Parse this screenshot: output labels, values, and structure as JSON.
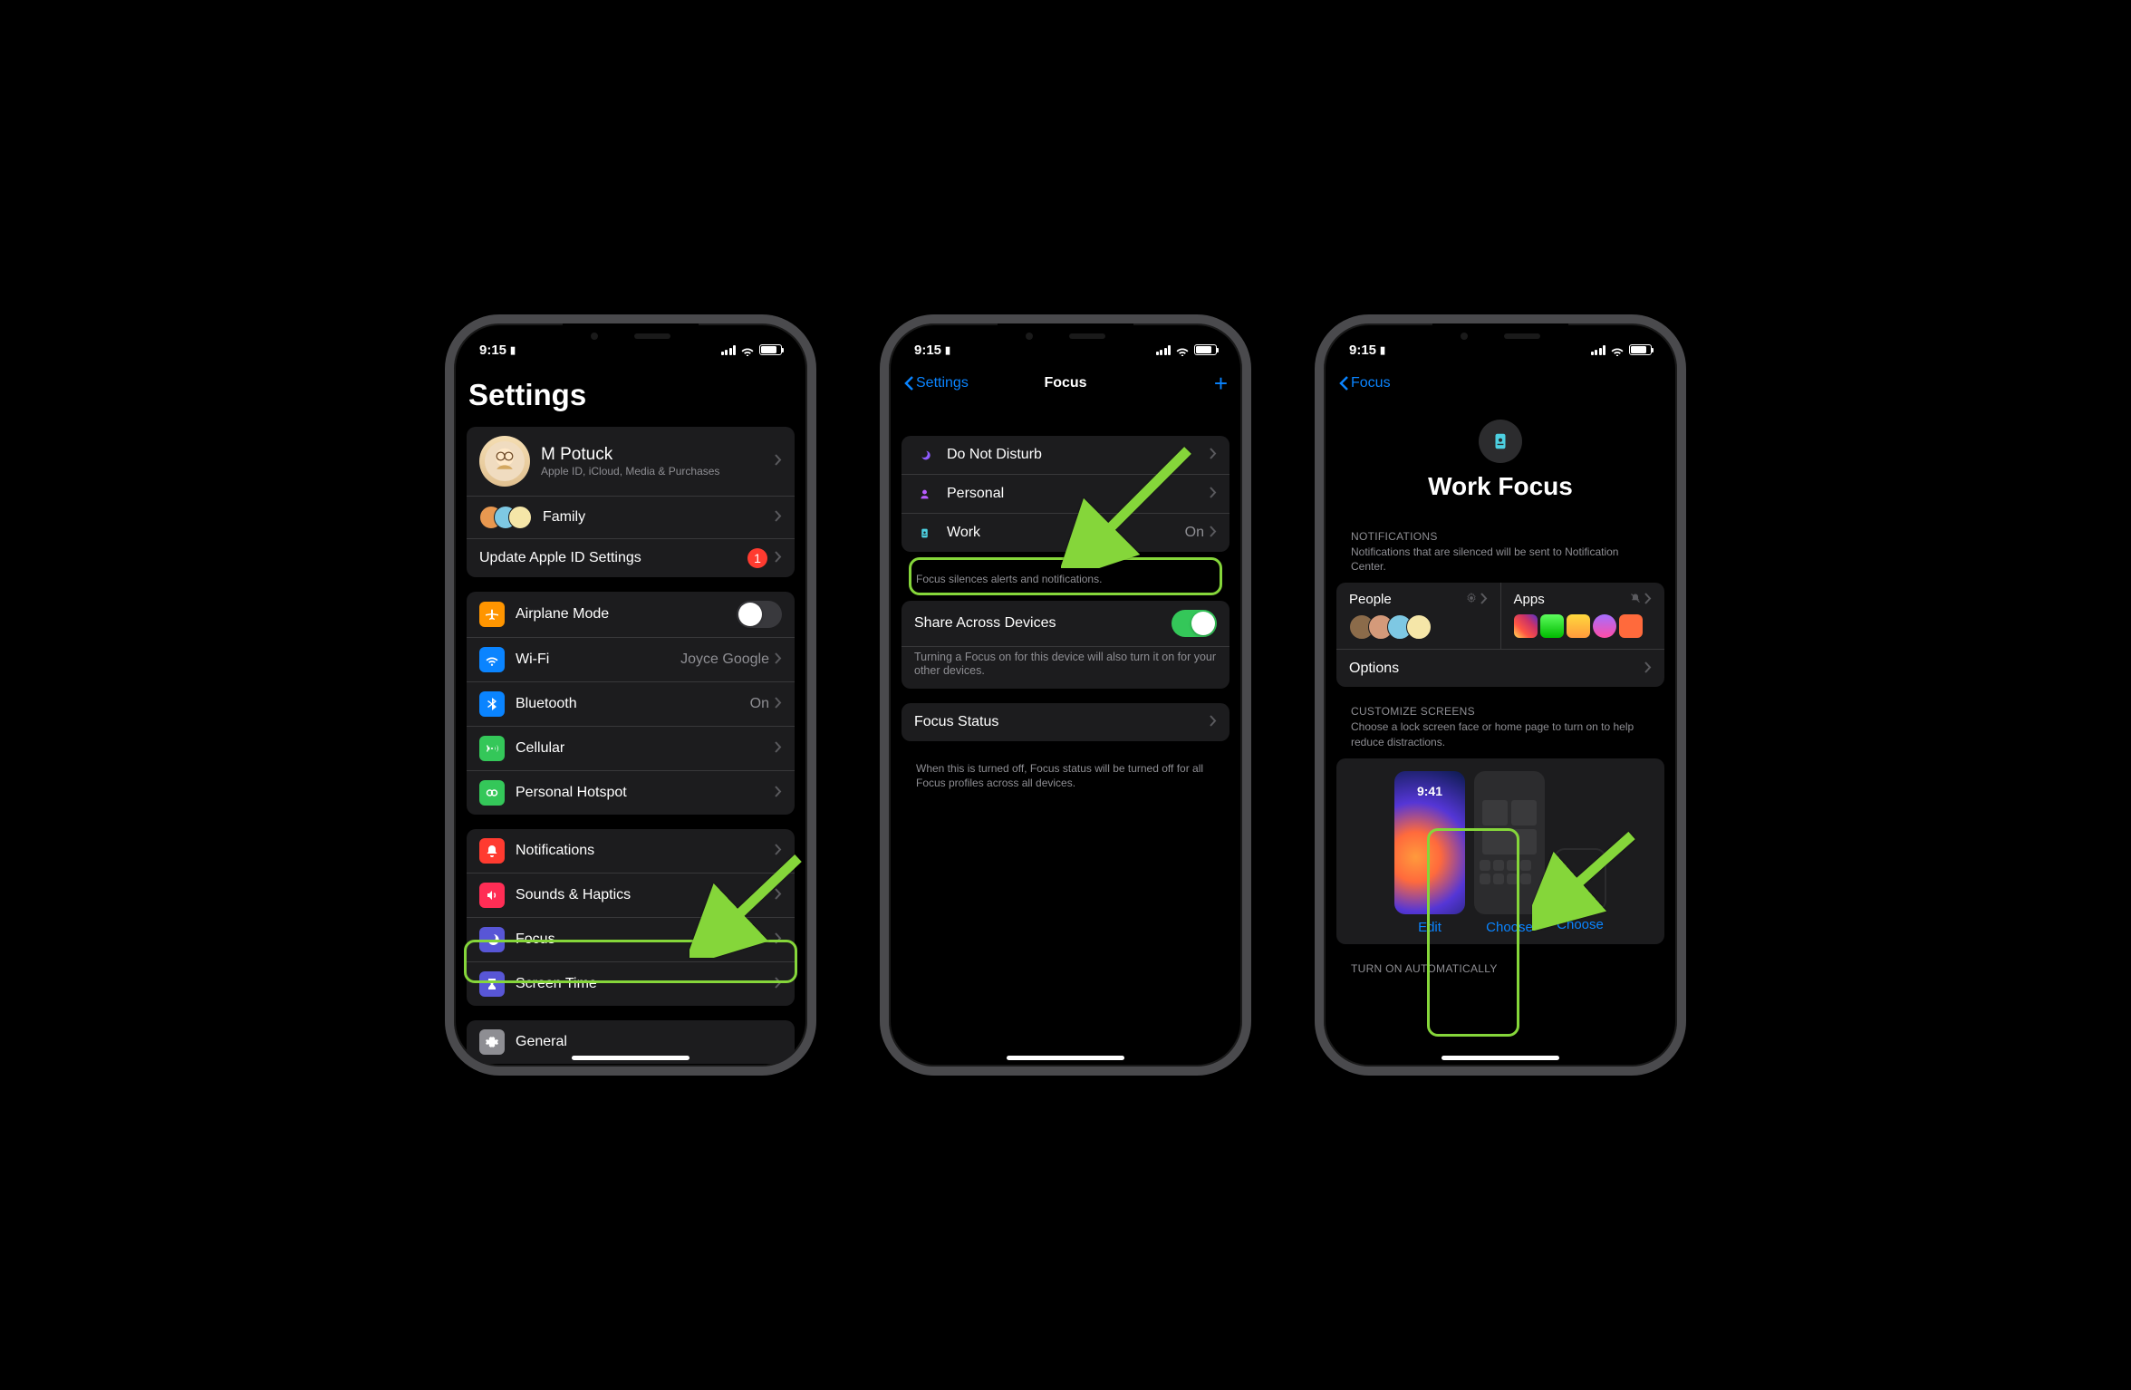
{
  "status": {
    "time": "9:15"
  },
  "s1": {
    "title": "Settings",
    "profile": {
      "name": "M Potuck",
      "sub": "Apple ID, iCloud, Media & Purchases"
    },
    "family": "Family",
    "update": {
      "label": "Update Apple ID Settings",
      "badge": "1"
    },
    "airplane": "Airplane Mode",
    "wifi": {
      "label": "Wi-Fi",
      "value": "Joyce Google"
    },
    "bluetooth": {
      "label": "Bluetooth",
      "value": "On"
    },
    "cellular": "Cellular",
    "hotspot": "Personal Hotspot",
    "notifications": "Notifications",
    "sounds": "Sounds & Haptics",
    "focus": "Focus",
    "screentime": "Screen Time",
    "general": "General"
  },
  "s2": {
    "back": "Settings",
    "title": "Focus",
    "dnd": "Do Not Disturb",
    "personal": "Personal",
    "work": {
      "label": "Work",
      "value": "On"
    },
    "footer1": "Focus silences alerts and notifications.",
    "share": "Share Across Devices",
    "footer2": "Turning a Focus on for this device will also turn it on for your other devices.",
    "status": "Focus Status",
    "footer3": "When this is turned off, Focus status will be turned off for all Focus profiles across all devices."
  },
  "s3": {
    "back": "Focus",
    "title": "Work Focus",
    "notif_header": "NOTIFICATIONS",
    "notif_sub": "Notifications that are silenced will be sent to Notification Center.",
    "people": "People",
    "apps": "Apps",
    "options": "Options",
    "cust_header": "CUSTOMIZE SCREENS",
    "cust_sub": "Choose a lock screen face or home page to turn on to help reduce distractions.",
    "edit": "Edit",
    "choose1": "Choose",
    "choose2": "Choose",
    "auto_header": "TURN ON AUTOMATICALLY",
    "lock_time": "9:41"
  }
}
